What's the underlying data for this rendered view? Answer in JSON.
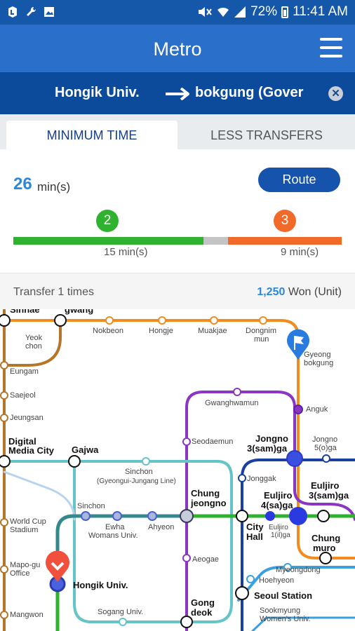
{
  "status_bar": {
    "battery": "72%",
    "time": "11:41 AM",
    "left_icons": [
      "notification-icon",
      "wrench-icon",
      "image-icon"
    ],
    "right_icons": [
      "mute-icon",
      "wifi-icon",
      "signal-icon",
      "battery-icon"
    ]
  },
  "app_bar": {
    "title": "Metro"
  },
  "route": {
    "from": "Hongik Univ.",
    "to": "bokgung (Gover"
  },
  "tabs": [
    {
      "label": "MINIMUM TIME",
      "active": true
    },
    {
      "label": "LESS TRANSFERS",
      "active": false
    }
  ],
  "summary": {
    "total_time": "26",
    "time_unit": "min(s)",
    "route_button": "Route",
    "segments": [
      {
        "line": "2",
        "color": "#2fb22f",
        "time": "15 min(s)"
      },
      {
        "line": "3",
        "color": "#f26a2a",
        "time": "9 min(s)"
      }
    ],
    "transfer_color": "#c4c4c4"
  },
  "info": {
    "transfers": "Transfer 1 times",
    "fare_amount": "1,250",
    "fare_unit": "Won (Unit)"
  },
  "map": {
    "stations": {
      "sinnae": "Sinnae",
      "gwang": "gwang",
      "yeokchon_1": "Yeok",
      "yeokchon_2": "chon",
      "nokbeon": "Nokbeon",
      "hongje": "Hongje",
      "muakjae": "Muakjae",
      "dongnimmun_1": "Dongnim",
      "dongnimmun_2": "mun",
      "gyeongbokgung_1": "Gyeong",
      "gyeongbokgung_2": "bokgung",
      "eungam": "Eungam",
      "saejeol": "Saejeol",
      "jeungsan": "Jeungsan",
      "gwanghwamun": "Gwanghwamun",
      "anguk": "Anguk",
      "seodaemun": "Seodaemun",
      "jongno3ga_1": "Jongno",
      "jongno3ga_2": "3(sam)ga",
      "jongno5ga_1": "Jongno",
      "jongno5ga_2": "5(o)ga",
      "dmc_1": "Digital",
      "dmc_2": "Media City",
      "gajwa": "Gajwa",
      "sinchon_gy_1": "Sinchon",
      "sinchon_gy_2": "(Gyeongui-Jungang Line)",
      "jonggak": "Jonggak",
      "euljiro3ga_1": "Euljiro",
      "euljiro3ga_2": "3(sam)ga",
      "chungjeongno_1": "Chung",
      "chungjeongno_2": "jeongno",
      "euljiro4ga_1": "Euljiro",
      "euljiro4ga_2": "4(sa)ga",
      "sinchon": "Sinchon",
      "ewha_1": "Ewha",
      "ewha_2": "Womans Univ.",
      "ahyeon": "Ahyeon",
      "cityhall_1": "City",
      "cityhall_2": "Hall",
      "euljiro1ga_1": "Euljiro",
      "euljiro1ga_2": "1(il)ga",
      "chungmuro_1": "Chung",
      "chungmuro_2": "muro",
      "worldcup_1": "World Cup",
      "worldcup_2": "Stadium",
      "aeogae": "Aeogae",
      "myeongdong": "Myeongdong",
      "hoehyeon": "Hoehyeon",
      "mapogu_1": "Mapo-gu",
      "mapogu_2": "Office",
      "hongik": "Hongik Univ.",
      "seoulstation": "Seoul Station",
      "gongdeok_1": "Gong",
      "gongdeok_2": "deok",
      "sookmyung_1": "Sookmyung",
      "sookmyung_2": "Women's Univ.",
      "mangwon": "Mangwon",
      "sogang": "Sogang Univ."
    },
    "line_colors": {
      "line1": "#1a3fa3",
      "line2": "#2fb22f",
      "line3": "#f28c1e",
      "line4": "#3aa0e0",
      "line5": "#8b36c2",
      "line6": "#b5762a",
      "airport": "#64c4c8"
    },
    "origin_pin_color": "#f0503c",
    "destination_pin_color": "#2a7be0"
  }
}
